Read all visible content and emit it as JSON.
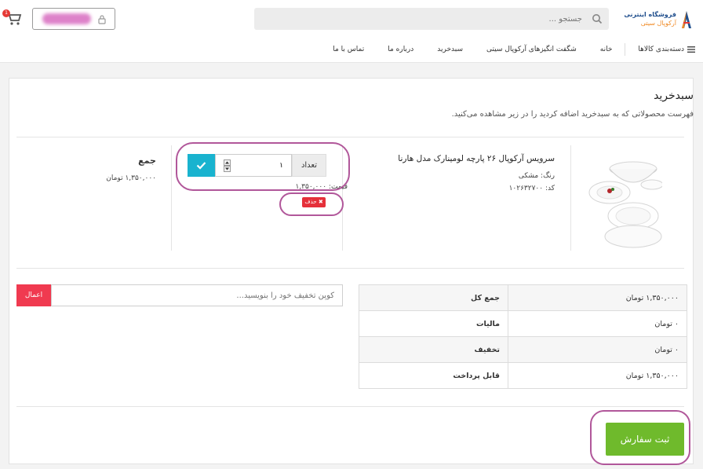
{
  "header": {
    "logo": {
      "shop_text": "فروشگاه اینترنی",
      "brand_text": "آرکوپال سیتی"
    },
    "search": {
      "placeholder": "جستجو ..."
    },
    "cart": {
      "count": "1"
    },
    "nav": {
      "categories": "دسته‌بندی کالاها",
      "items": [
        "خانه",
        "شگفت انگیزهای آرکوپال سیتی",
        "سبدخرید",
        "درباره ما",
        "تماس با ما"
      ]
    }
  },
  "cart_page": {
    "title": "سبدخرید",
    "subtitle": "فهرست محصولاتی که به سبدخرید اضافه کردید را در زیر مشاهده می‌کنید.",
    "item": {
      "name": "سرویس آرکوپال ۲۶ پارچه لومینارک مدل هارنا",
      "color": "رنگ: مشکی",
      "code": "کد: ۱۰۲۶۳۲۷۰۰",
      "qty_label": "تعداد",
      "qty_value": "۱",
      "price": "قیمت: ۱,۳۵۰,۰۰۰",
      "delete_label": "حذف"
    },
    "total": {
      "label": "جمع",
      "value": "۱,۳۵۰,۰۰۰ تومان"
    },
    "coupon": {
      "placeholder": "کوپن تخفیف خود را بنویسید...",
      "apply_label": "اعمال"
    },
    "summary": [
      {
        "label": "جمع کل",
        "value": "۱,۳۵۰,۰۰۰ تومان"
      },
      {
        "label": "مالیات",
        "value": "۰ تومان"
      },
      {
        "label": "تخفیف",
        "value": "۰ تومان"
      },
      {
        "label": "قابل پرداخت",
        "value": "۱,۳۵۰,۰۰۰ تومان"
      }
    ],
    "checkout_label": "ثبت سفارش"
  },
  "colors": {
    "accent_cyan": "#19b3cf",
    "delete_red": "#e5303a",
    "apply_red": "#f03a50",
    "checkout_green": "#6fba2c",
    "annotation_purple": "#b1579a"
  }
}
